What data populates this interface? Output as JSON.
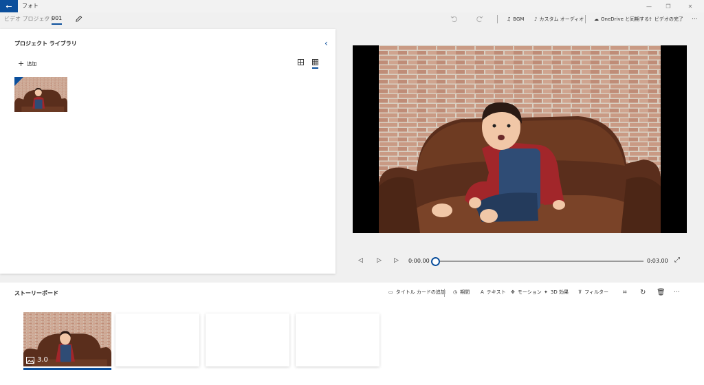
{
  "window": {
    "title": "フォト",
    "back_icon": "back-arrow-icon",
    "accent": "#0b4f9c"
  },
  "breadcrumb": {
    "parent": "ビデオ プロジェクト",
    "separator": ">",
    "current": "001"
  },
  "toolbar": {
    "bgm_label": "BGM",
    "custom_audio_label": "カスタム オーディオ",
    "onedrive_label": "OneDrive と同期する",
    "finish_video_label": "ビデオの完了",
    "more_label": "···"
  },
  "library": {
    "title": "プロジェクト ライブラリ",
    "add_label": "追加"
  },
  "player": {
    "current_time": "0:00.00",
    "total_time": "0:03.00",
    "progress": 0
  },
  "storyboard": {
    "title": "ストーリーボード",
    "tools": {
      "title_card": "タイトル カードの追加",
      "duration": "期間",
      "text": "テキスト",
      "motion": "モーション",
      "effects_3d": "3D 効果",
      "filters": "フィルター",
      "more": "···"
    },
    "clips": [
      {
        "duration": "3.0"
      }
    ]
  }
}
